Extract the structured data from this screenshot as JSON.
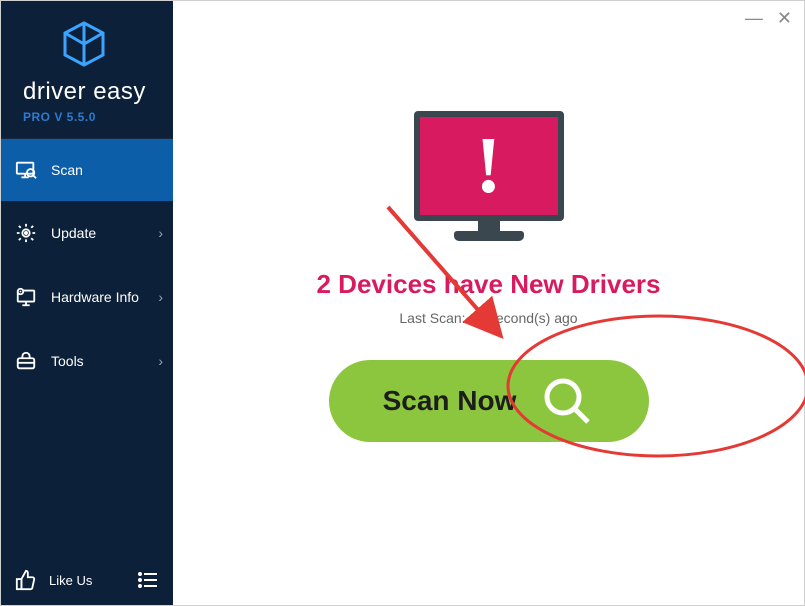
{
  "brand": {
    "name1": "driver",
    "name2": "easy",
    "version": "PRO V 5.5.0"
  },
  "nav": {
    "scan": {
      "label": "Scan"
    },
    "update": {
      "label": "Update"
    },
    "hw": {
      "label": "Hardware Info"
    },
    "tools": {
      "label": "Tools"
    }
  },
  "bottom": {
    "like": "Like Us"
  },
  "main": {
    "headline": "2 Devices have New Drivers",
    "subline": "Last Scan: 13 second(s) ago",
    "scan_button": "Scan Now"
  }
}
